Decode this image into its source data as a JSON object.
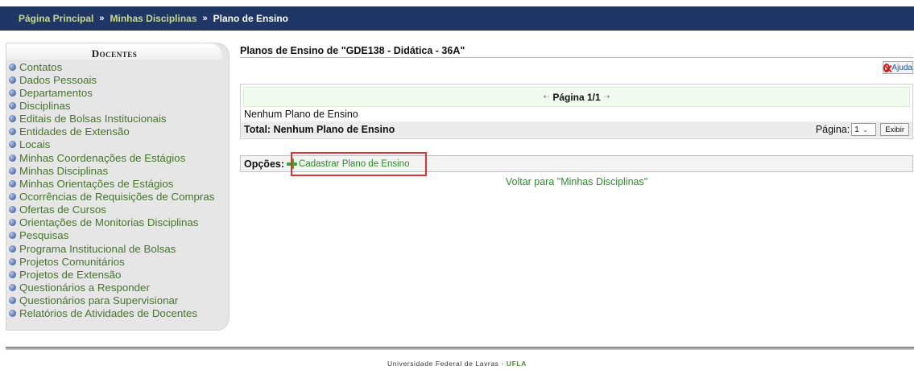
{
  "breadcrumb": {
    "home": "Página Principal",
    "separator": "»",
    "subjects": "Minhas Disciplinas",
    "current": "Plano de Ensino"
  },
  "sidebar": {
    "title": "Docentes",
    "items": [
      "Contatos",
      "Dados Pessoais",
      "Departamentos",
      "Disciplinas",
      "Editais de Bolsas Institucionais",
      "Entidades de Extensão",
      "Locais",
      "Minhas Coordenações de Estágios",
      "Minhas Disciplinas",
      "Minhas Orientações de Estágios",
      "Ocorrências de Requisições de Compras",
      "Ofertas de Cursos",
      "Orientações de Monitorias Disciplinas",
      "Pesquisas",
      "Programa Institucional de Bolsas",
      "Projetos Comunitários",
      "Projetos de Extensão",
      "Questionários a Responder",
      "Questionários para Supervisionar",
      "Relatórios de Atividades de Docentes"
    ]
  },
  "main": {
    "title": "Planos de Ensino de \"GDE138 - Didática - 36A\"",
    "help_label": "Ajuda",
    "pager": {
      "prev_arrow": "⇠",
      "label": "Página 1/1",
      "next_arrow": "⇢"
    },
    "empty_message": "Nenhum Plano de Ensino",
    "total_label": "Total: Nenhum Plano de Ensino",
    "page_select_label": "Página:",
    "page_select_value": "1",
    "show_button": "Exibir",
    "options_label": "Opções:",
    "add_plan_link": "Cadastrar Plano de Ensino",
    "back_link": "Voltar para \"Minhas Disciplinas\""
  },
  "footer": {
    "text": "Universidade Federal de Lavras - ",
    "strong": "UFLA"
  },
  "colors": {
    "topbar": "#1e3767",
    "link_green": "#2c8a2c",
    "highlight_red": "#e03030"
  }
}
